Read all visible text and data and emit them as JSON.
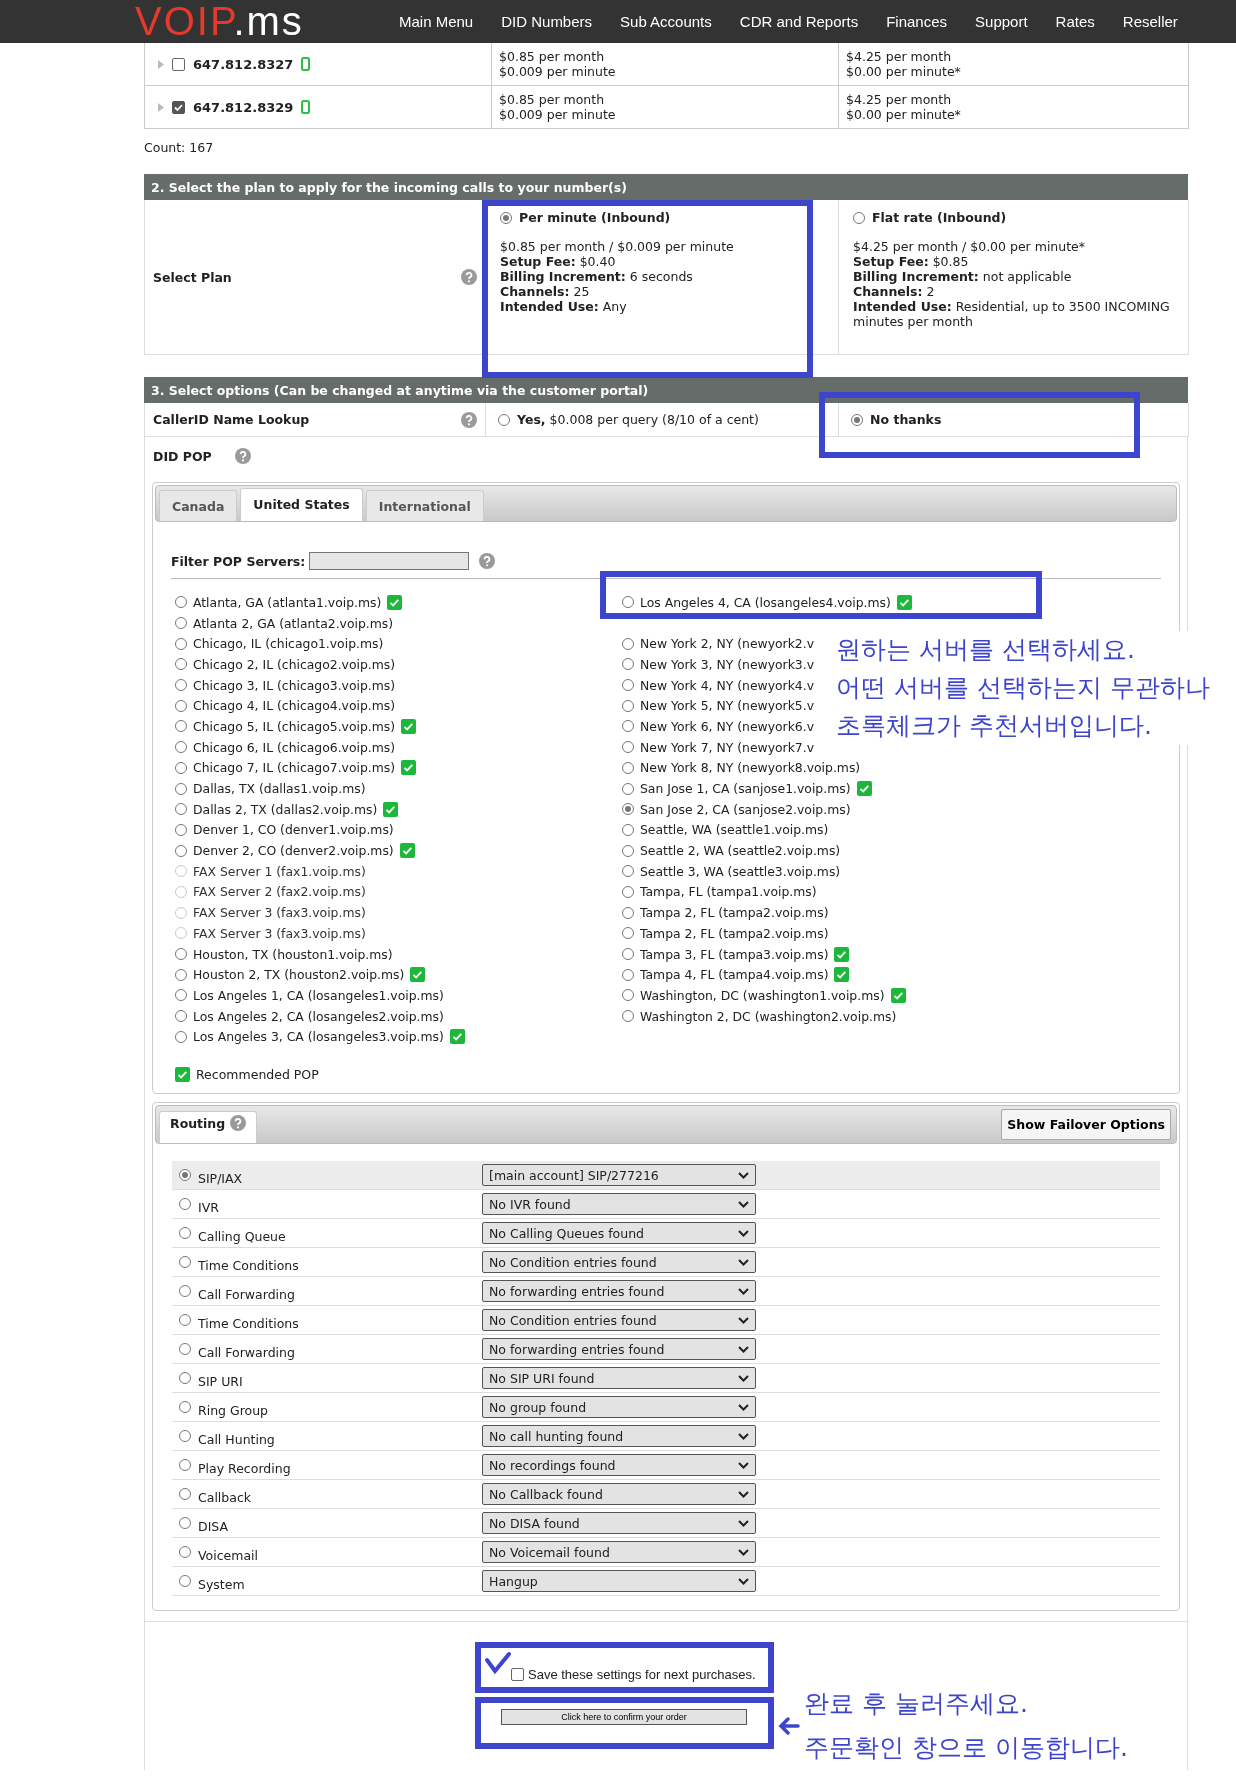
{
  "header": {
    "logo": {
      "main": "VOIP",
      "suffix": ".ms"
    },
    "nav": [
      "Main Menu",
      "DID Numbers",
      "Sub Accounts",
      "CDR and Reports",
      "Finances",
      "Support",
      "Rates",
      "Reseller"
    ]
  },
  "numbers": {
    "rows": [
      {
        "number": "647.812.8327",
        "checked": false,
        "per_minute": [
          "$0.85 per month",
          "$0.009 per minute"
        ],
        "flat_rate": [
          "$4.25 per month",
          "$0.00 per minute*"
        ]
      },
      {
        "number": "647.812.8329",
        "checked": true,
        "per_minute": [
          "$0.85 per month",
          "$0.009 per minute"
        ],
        "flat_rate": [
          "$4.25 per month",
          "$0.00 per minute*"
        ]
      }
    ],
    "count": "Count: 167"
  },
  "plan_section": {
    "title": "2. Select the plan to apply for the incoming calls to your number(s)",
    "label": "Select Plan",
    "plans": [
      {
        "name": "Per minute (Inbound)",
        "selected": true,
        "lines": [
          "$0.85 per month / $0.009 per minute",
          "**Setup Fee:** $0.40",
          "**Billing Increment:** 6 seconds",
          "**Channels:** 25",
          "**Intended Use:** Any"
        ]
      },
      {
        "name": "Flat rate (Inbound)",
        "selected": false,
        "lines": [
          "$4.25 per month / $0.00 per minute*",
          "**Setup Fee:** $0.85",
          "**Billing Increment:** not applicable",
          "**Channels:** 2",
          "**Intended Use:** Residential, up to 3500 INCOMING minutes per month"
        ]
      }
    ]
  },
  "options_section": {
    "title": "3. Select options (Can be changed at anytime via the customer portal)",
    "callerid": {
      "label": "CallerID Name Lookup",
      "yes": {
        "text": "**Yes,** $0.008 per query (8/10 of a cent)",
        "selected": false
      },
      "no": {
        "text": "No thanks",
        "selected": true
      }
    },
    "did_pop": {
      "label": "DID POP",
      "tabs": [
        {
          "label": "Canada",
          "selected": false
        },
        {
          "label": "United States",
          "selected": true
        },
        {
          "label": "International",
          "selected": false
        }
      ],
      "filter_label": "Filter POP Servers:",
      "columns": [
        [
          {
            "name": "Atlanta, GA (atlanta1.voip.ms)",
            "selected": false,
            "disabled": false,
            "recommended": true
          },
          {
            "name": "Atlanta 2, GA (atlanta2.voip.ms)",
            "selected": false,
            "disabled": false,
            "recommended": false
          },
          {
            "name": "Chicago, IL (chicago1.voip.ms)",
            "selected": false,
            "disabled": false,
            "recommended": false
          },
          {
            "name": "Chicago 2, IL (chicago2.voip.ms)",
            "selected": false,
            "disabled": false,
            "recommended": false
          },
          {
            "name": "Chicago 3, IL (chicago3.voip.ms)",
            "selected": false,
            "disabled": false,
            "recommended": false
          },
          {
            "name": "Chicago 4, IL (chicago4.voip.ms)",
            "selected": false,
            "disabled": false,
            "recommended": false
          },
          {
            "name": "Chicago 5, IL (chicago5.voip.ms)",
            "selected": false,
            "disabled": false,
            "recommended": true
          },
          {
            "name": "Chicago 6, IL (chicago6.voip.ms)",
            "selected": false,
            "disabled": false,
            "recommended": false
          },
          {
            "name": "Chicago 7, IL (chicago7.voip.ms)",
            "selected": false,
            "disabled": false,
            "recommended": true
          },
          {
            "name": "Dallas, TX (dallas1.voip.ms)",
            "selected": false,
            "disabled": false,
            "recommended": false
          },
          {
            "name": "Dallas 2, TX (dallas2.voip.ms)",
            "selected": false,
            "disabled": false,
            "recommended": true
          },
          {
            "name": "Denver 1, CO (denver1.voip.ms)",
            "selected": false,
            "disabled": false,
            "recommended": false
          },
          {
            "name": "Denver 2, CO (denver2.voip.ms)",
            "selected": false,
            "disabled": false,
            "recommended": true
          },
          {
            "name": "FAX Server 1 (fax1.voip.ms)",
            "selected": false,
            "disabled": true,
            "recommended": false
          },
          {
            "name": "FAX Server 2 (fax2.voip.ms)",
            "selected": false,
            "disabled": true,
            "recommended": false
          },
          {
            "name": "FAX Server 3 (fax3.voip.ms)",
            "selected": false,
            "disabled": true,
            "recommended": false
          },
          {
            "name": "FAX Server 3 (fax3.voip.ms)",
            "selected": false,
            "disabled": true,
            "recommended": false
          },
          {
            "name": "Houston, TX (houston1.voip.ms)",
            "selected": false,
            "disabled": false,
            "recommended": false
          },
          {
            "name": "Houston 2, TX (houston2.voip.ms)",
            "selected": false,
            "disabled": false,
            "recommended": true
          },
          {
            "name": "Los Angeles 1, CA (losangeles1.voip.ms)",
            "selected": false,
            "disabled": false,
            "recommended": false
          },
          {
            "name": "Los Angeles 2, CA (losangeles2.voip.ms)",
            "selected": false,
            "disabled": false,
            "recommended": false
          },
          {
            "name": "Los Angeles 3, CA (losangeles3.voip.ms)",
            "selected": false,
            "disabled": false,
            "recommended": true
          }
        ],
        [
          {
            "name": "Los Angeles 4, CA (losangeles4.voip.ms)",
            "selected": false,
            "disabled": false,
            "recommended": true
          },
          {
            "name": "New York 2, NY (newyork2.v",
            "selected": false,
            "disabled": false,
            "recommended": false
          },
          {
            "name": "New York 3, NY (newyork3.v",
            "selected": false,
            "disabled": false,
            "recommended": false
          },
          {
            "name": "New York 4, NY (newyork4.v",
            "selected": false,
            "disabled": false,
            "recommended": false
          },
          {
            "name": "New York 5, NY (newyork5.v",
            "selected": false,
            "disabled": false,
            "recommended": false
          },
          {
            "name": "New York 6, NY (newyork6.v",
            "selected": false,
            "disabled": false,
            "recommended": false
          },
          {
            "name": "New York 7, NY (newyork7.v",
            "selected": false,
            "disabled": false,
            "recommended": false
          },
          {
            "name": "New York 8, NY (newyork8.voip.ms)",
            "selected": false,
            "disabled": false,
            "recommended": false
          },
          {
            "name": "San Jose 1, CA (sanjose1.voip.ms)",
            "selected": false,
            "disabled": false,
            "recommended": true
          },
          {
            "name": "San Jose 2, CA (sanjose2.voip.ms)",
            "selected": true,
            "disabled": false,
            "recommended": false
          },
          {
            "name": "Seattle, WA (seattle1.voip.ms)",
            "selected": false,
            "disabled": false,
            "recommended": false
          },
          {
            "name": "Seattle 2, WA (seattle2.voip.ms)",
            "selected": false,
            "disabled": false,
            "recommended": false
          },
          {
            "name": "Seattle 3, WA (seattle3.voip.ms)",
            "selected": false,
            "disabled": false,
            "recommended": false
          },
          {
            "name": "Tampa, FL (tampa1.voip.ms)",
            "selected": false,
            "disabled": false,
            "recommended": false
          },
          {
            "name": "Tampa 2, FL (tampa2.voip.ms)",
            "selected": false,
            "disabled": false,
            "recommended": false
          },
          {
            "name": "Tampa 2, FL (tampa2.voip.ms)",
            "selected": false,
            "disabled": false,
            "recommended": false
          },
          {
            "name": "Tampa 3, FL (tampa3.voip.ms)",
            "selected": false,
            "disabled": false,
            "recommended": true
          },
          {
            "name": "Tampa 4, FL (tampa4.voip.ms)",
            "selected": false,
            "disabled": false,
            "recommended": true
          },
          {
            "name": "Washington, DC (washington1.voip.ms)",
            "selected": false,
            "disabled": false,
            "recommended": true
          },
          {
            "name": "Washington 2, DC (washington2.voip.ms)",
            "selected": false,
            "disabled": false,
            "recommended": false
          }
        ]
      ],
      "legend": "Recommended POP"
    }
  },
  "routing": {
    "tab": "Routing",
    "failover_button": "Show Failover Options",
    "rows": [
      {
        "label": "SIP/IAX",
        "selected": true,
        "value": "[main account] SIP/277216"
      },
      {
        "label": "IVR",
        "selected": false,
        "value": "No IVR found"
      },
      {
        "label": "Calling Queue",
        "selected": false,
        "value": "No Calling Queues found"
      },
      {
        "label": "Time Conditions",
        "selected": false,
        "value": "No Condition entries found"
      },
      {
        "label": "Call Forwarding",
        "selected": false,
        "value": "No forwarding entries found"
      },
      {
        "label": "Time Conditions",
        "selected": false,
        "value": "No Condition entries found"
      },
      {
        "label": "Call Forwarding",
        "selected": false,
        "value": "No forwarding entries found"
      },
      {
        "label": "SIP URI",
        "selected": false,
        "value": "No SIP URI found"
      },
      {
        "label": "Ring Group",
        "selected": false,
        "value": "No group found"
      },
      {
        "label": "Call Hunting",
        "selected": false,
        "value": "No call hunting found"
      },
      {
        "label": "Play Recording",
        "selected": false,
        "value": "No recordings found"
      },
      {
        "label": "Callback",
        "selected": false,
        "value": "No Callback found"
      },
      {
        "label": "DISA",
        "selected": false,
        "value": "No DISA found"
      },
      {
        "label": "Voicemail",
        "selected": false,
        "value": "No Voicemail found"
      },
      {
        "label": "System",
        "selected": false,
        "value": "Hangup"
      }
    ]
  },
  "footer": {
    "save_label": "Save these settings for next purchases.",
    "save_checked": false,
    "confirm_button": "Click here to confirm your order"
  },
  "annotations": {
    "server_note": [
      "원하는 서버를 선택하세요.",
      "어떤 서버를 선택하는지 무관하나",
      "초록체크가 추천서버입니다."
    ],
    "confirm_note": [
      "완료 후 눌러주세요.",
      "주문확인 창으로 이동합니다."
    ]
  }
}
